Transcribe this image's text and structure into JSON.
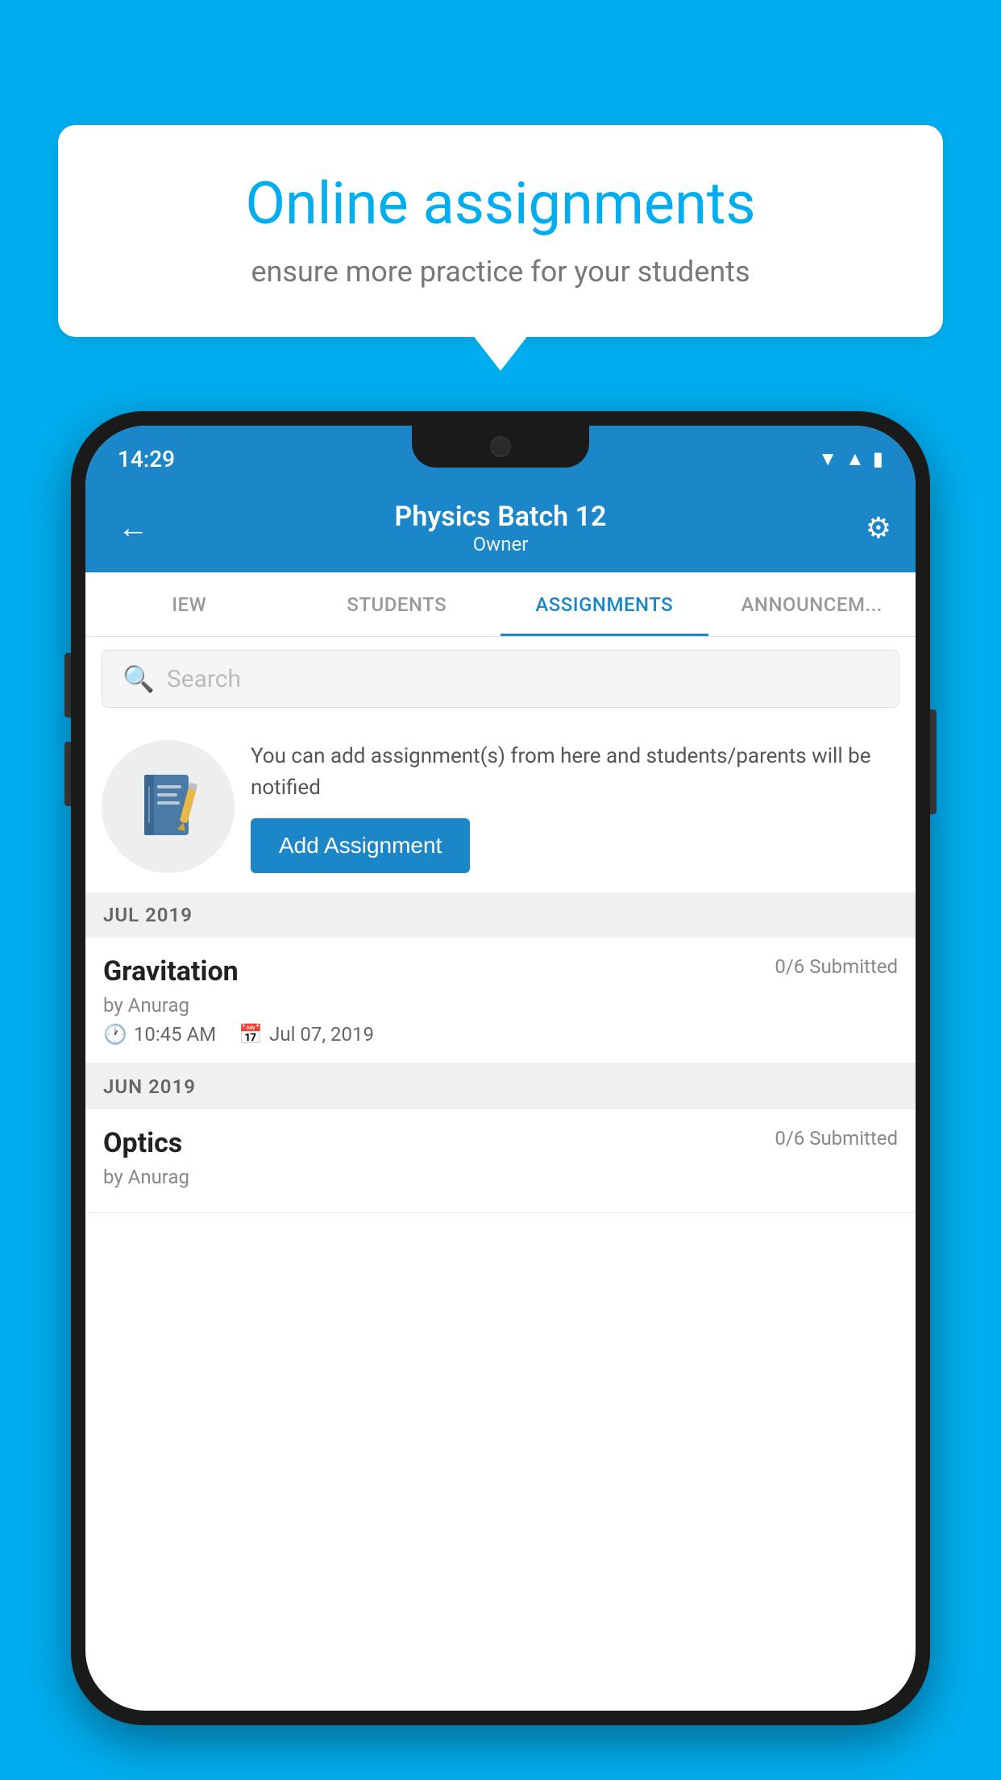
{
  "background_color": "#00AEEF",
  "speech_bubble": {
    "title": "Online assignments",
    "subtitle": "ensure more practice for your students"
  },
  "status_bar": {
    "time": "14:29",
    "icons": [
      "wifi",
      "signal",
      "battery"
    ]
  },
  "header": {
    "title": "Physics Batch 12",
    "subtitle": "Owner",
    "back_label": "←",
    "settings_label": "⚙"
  },
  "tabs": [
    {
      "label": "IEW",
      "active": false
    },
    {
      "label": "STUDENTS",
      "active": false
    },
    {
      "label": "ASSIGNMENTS",
      "active": true
    },
    {
      "label": "ANNOUNCEM...",
      "active": false
    }
  ],
  "search": {
    "placeholder": "Search"
  },
  "promo": {
    "text": "You can add assignment(s) from here and students/parents will be notified",
    "button_label": "Add Assignment"
  },
  "month_sections": [
    {
      "month_label": "JUL 2019",
      "assignments": [
        {
          "title": "Gravitation",
          "submitted": "0/6 Submitted",
          "by": "by Anurag",
          "time": "10:45 AM",
          "date": "Jul 07, 2019"
        }
      ]
    },
    {
      "month_label": "JUN 2019",
      "assignments": [
        {
          "title": "Optics",
          "submitted": "0/6 Submitted",
          "by": "by Anurag",
          "time": "",
          "date": ""
        }
      ]
    }
  ]
}
